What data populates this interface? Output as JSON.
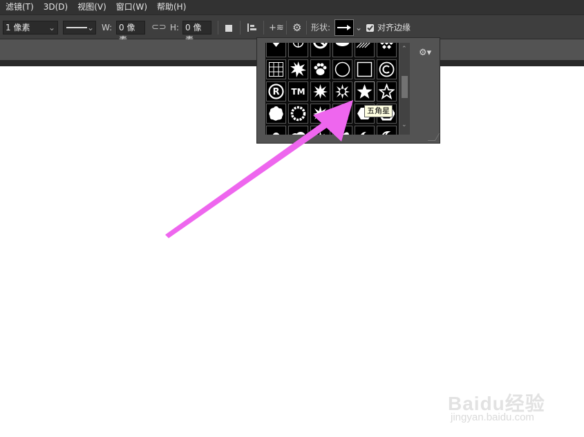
{
  "menu": [
    {
      "label": "滤镜(T)"
    },
    {
      "label": "3D(D)"
    },
    {
      "label": "视图(V)"
    },
    {
      "label": "窗口(W)"
    },
    {
      "label": "帮助(H)"
    }
  ],
  "options_bar": {
    "stroke_width": "1 像素",
    "w_label": "W:",
    "w_value": "0 像素",
    "h_label": "H:",
    "h_value": "0 像素",
    "shape_label": "形状:",
    "align_edges_label": "对齐边缘",
    "align_edges_checked": true
  },
  "shape_picker": {
    "tooltip": "五角星",
    "selected_shape": "star-5-point",
    "shapes": [
      "heart-card",
      "target",
      "no-sign",
      "speech-bubble",
      "hatch",
      "diamonds",
      "grid",
      "burst",
      "paw",
      "circle",
      "square-frame",
      "copyright",
      "registered",
      "trademark",
      "burst-8",
      "burst-ring",
      "star-5-point",
      "star-outline",
      "blob",
      "circle-ring",
      "burst-small",
      "burst-small-2",
      "hexagon",
      "hexagon-2",
      "clover",
      "cloud",
      "burst-3",
      "heart",
      "moon",
      "moon-2"
    ]
  },
  "watermark": {
    "logo": "Baidu经验",
    "url": "jingyan.baidu.com"
  },
  "colors": {
    "annotation_arrow": "#ee66ee",
    "menubar_bg": "#323232",
    "options_bg": "#3e3e3e",
    "panel_bg": "#535353"
  }
}
